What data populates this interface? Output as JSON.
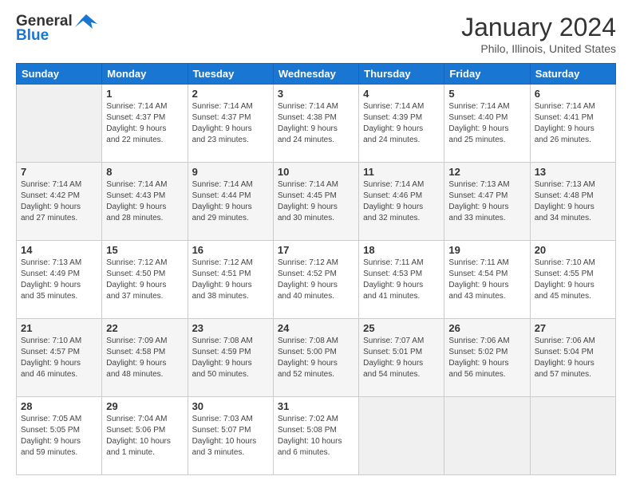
{
  "logo": {
    "line1": "General",
    "line2": "Blue"
  },
  "header": {
    "title": "January 2024",
    "subtitle": "Philo, Illinois, United States"
  },
  "days_of_week": [
    "Sunday",
    "Monday",
    "Tuesday",
    "Wednesday",
    "Thursday",
    "Friday",
    "Saturday"
  ],
  "weeks": [
    [
      {
        "day": "",
        "info": ""
      },
      {
        "day": "1",
        "info": "Sunrise: 7:14 AM\nSunset: 4:37 PM\nDaylight: 9 hours\nand 22 minutes."
      },
      {
        "day": "2",
        "info": "Sunrise: 7:14 AM\nSunset: 4:37 PM\nDaylight: 9 hours\nand 23 minutes."
      },
      {
        "day": "3",
        "info": "Sunrise: 7:14 AM\nSunset: 4:38 PM\nDaylight: 9 hours\nand 24 minutes."
      },
      {
        "day": "4",
        "info": "Sunrise: 7:14 AM\nSunset: 4:39 PM\nDaylight: 9 hours\nand 24 minutes."
      },
      {
        "day": "5",
        "info": "Sunrise: 7:14 AM\nSunset: 4:40 PM\nDaylight: 9 hours\nand 25 minutes."
      },
      {
        "day": "6",
        "info": "Sunrise: 7:14 AM\nSunset: 4:41 PM\nDaylight: 9 hours\nand 26 minutes."
      }
    ],
    [
      {
        "day": "7",
        "info": "Sunrise: 7:14 AM\nSunset: 4:42 PM\nDaylight: 9 hours\nand 27 minutes."
      },
      {
        "day": "8",
        "info": "Sunrise: 7:14 AM\nSunset: 4:43 PM\nDaylight: 9 hours\nand 28 minutes."
      },
      {
        "day": "9",
        "info": "Sunrise: 7:14 AM\nSunset: 4:44 PM\nDaylight: 9 hours\nand 29 minutes."
      },
      {
        "day": "10",
        "info": "Sunrise: 7:14 AM\nSunset: 4:45 PM\nDaylight: 9 hours\nand 30 minutes."
      },
      {
        "day": "11",
        "info": "Sunrise: 7:14 AM\nSunset: 4:46 PM\nDaylight: 9 hours\nand 32 minutes."
      },
      {
        "day": "12",
        "info": "Sunrise: 7:13 AM\nSunset: 4:47 PM\nDaylight: 9 hours\nand 33 minutes."
      },
      {
        "day": "13",
        "info": "Sunrise: 7:13 AM\nSunset: 4:48 PM\nDaylight: 9 hours\nand 34 minutes."
      }
    ],
    [
      {
        "day": "14",
        "info": "Sunrise: 7:13 AM\nSunset: 4:49 PM\nDaylight: 9 hours\nand 35 minutes."
      },
      {
        "day": "15",
        "info": "Sunrise: 7:12 AM\nSunset: 4:50 PM\nDaylight: 9 hours\nand 37 minutes."
      },
      {
        "day": "16",
        "info": "Sunrise: 7:12 AM\nSunset: 4:51 PM\nDaylight: 9 hours\nand 38 minutes."
      },
      {
        "day": "17",
        "info": "Sunrise: 7:12 AM\nSunset: 4:52 PM\nDaylight: 9 hours\nand 40 minutes."
      },
      {
        "day": "18",
        "info": "Sunrise: 7:11 AM\nSunset: 4:53 PM\nDaylight: 9 hours\nand 41 minutes."
      },
      {
        "day": "19",
        "info": "Sunrise: 7:11 AM\nSunset: 4:54 PM\nDaylight: 9 hours\nand 43 minutes."
      },
      {
        "day": "20",
        "info": "Sunrise: 7:10 AM\nSunset: 4:55 PM\nDaylight: 9 hours\nand 45 minutes."
      }
    ],
    [
      {
        "day": "21",
        "info": "Sunrise: 7:10 AM\nSunset: 4:57 PM\nDaylight: 9 hours\nand 46 minutes."
      },
      {
        "day": "22",
        "info": "Sunrise: 7:09 AM\nSunset: 4:58 PM\nDaylight: 9 hours\nand 48 minutes."
      },
      {
        "day": "23",
        "info": "Sunrise: 7:08 AM\nSunset: 4:59 PM\nDaylight: 9 hours\nand 50 minutes."
      },
      {
        "day": "24",
        "info": "Sunrise: 7:08 AM\nSunset: 5:00 PM\nDaylight: 9 hours\nand 52 minutes."
      },
      {
        "day": "25",
        "info": "Sunrise: 7:07 AM\nSunset: 5:01 PM\nDaylight: 9 hours\nand 54 minutes."
      },
      {
        "day": "26",
        "info": "Sunrise: 7:06 AM\nSunset: 5:02 PM\nDaylight: 9 hours\nand 56 minutes."
      },
      {
        "day": "27",
        "info": "Sunrise: 7:06 AM\nSunset: 5:04 PM\nDaylight: 9 hours\nand 57 minutes."
      }
    ],
    [
      {
        "day": "28",
        "info": "Sunrise: 7:05 AM\nSunset: 5:05 PM\nDaylight: 9 hours\nand 59 minutes."
      },
      {
        "day": "29",
        "info": "Sunrise: 7:04 AM\nSunset: 5:06 PM\nDaylight: 10 hours\nand 1 minute."
      },
      {
        "day": "30",
        "info": "Sunrise: 7:03 AM\nSunset: 5:07 PM\nDaylight: 10 hours\nand 3 minutes."
      },
      {
        "day": "31",
        "info": "Sunrise: 7:02 AM\nSunset: 5:08 PM\nDaylight: 10 hours\nand 6 minutes."
      },
      {
        "day": "",
        "info": ""
      },
      {
        "day": "",
        "info": ""
      },
      {
        "day": "",
        "info": ""
      }
    ]
  ]
}
